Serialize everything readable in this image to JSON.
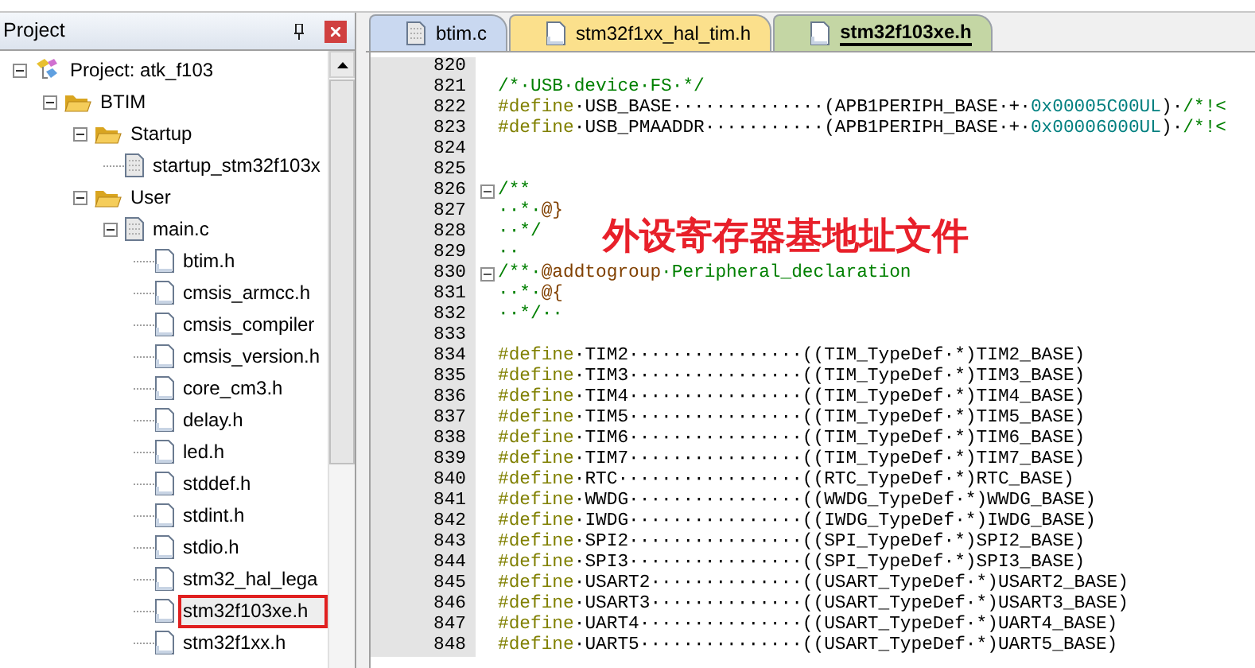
{
  "project_panel": {
    "title": "Project",
    "tree": [
      {
        "label": "Project: atk_f103",
        "kind": "project",
        "expanded": true,
        "selected": false,
        "children": [
          {
            "label": "BTIM",
            "kind": "target",
            "expanded": true,
            "selected": false,
            "children": [
              {
                "label": "Startup",
                "kind": "group",
                "expanded": true,
                "selected": false,
                "children": [
                  {
                    "label": "startup_stm32f103x",
                    "kind": "source",
                    "selected": false
                  }
                ]
              },
              {
                "label": "User",
                "kind": "group",
                "expanded": true,
                "selected": false,
                "children": [
                  {
                    "label": "main.c",
                    "kind": "source",
                    "expanded": true,
                    "selected": false,
                    "children": [
                      {
                        "label": "btim.h",
                        "kind": "header",
                        "selected": false
                      },
                      {
                        "label": "cmsis_armcc.h",
                        "kind": "header",
                        "selected": false
                      },
                      {
                        "label": "cmsis_compiler",
                        "kind": "header",
                        "selected": false
                      },
                      {
                        "label": "cmsis_version.h",
                        "kind": "header",
                        "selected": false
                      },
                      {
                        "label": "core_cm3.h",
                        "kind": "header",
                        "selected": false
                      },
                      {
                        "label": "delay.h",
                        "kind": "header",
                        "selected": false
                      },
                      {
                        "label": "led.h",
                        "kind": "header",
                        "selected": false
                      },
                      {
                        "label": "stddef.h",
                        "kind": "header",
                        "selected": false
                      },
                      {
                        "label": "stdint.h",
                        "kind": "header",
                        "selected": false
                      },
                      {
                        "label": "stdio.h",
                        "kind": "header",
                        "selected": false
                      },
                      {
                        "label": "stm32_hal_lega",
                        "kind": "header",
                        "selected": false
                      },
                      {
                        "label": "stm32f103xe.h",
                        "kind": "header",
                        "selected": true
                      },
                      {
                        "label": "stm32f1xx.h",
                        "kind": "header",
                        "selected": false
                      }
                    ]
                  }
                ]
              }
            ]
          }
        ]
      }
    ]
  },
  "tabs": [
    {
      "label": "btim.c",
      "selected": false,
      "color": "#c9d8f0"
    },
    {
      "label": "stm32f1xx_hal_tim.h",
      "selected": false,
      "color": "#fbe08c"
    },
    {
      "label": "stm32f103xe.h",
      "selected": true,
      "color": "#c4d6a4"
    }
  ],
  "annotation": "外设寄存器基地址文件",
  "code_lines": [
    {
      "number": "820",
      "fold": false
    },
    {
      "number": "821",
      "fold": false,
      "parts": [
        {
          "kind": "comment",
          "text": "/*·USB·device·FS·*/"
        }
      ]
    },
    {
      "number": "822",
      "fold": false,
      "parts": [
        {
          "kind": "keyword",
          "text": "#define"
        },
        {
          "kind": "plain",
          "text": "·USB_BASE··············(APB1PERIPH_BASE·+·"
        },
        {
          "kind": "number",
          "text": "0x00005C00UL"
        },
        {
          "kind": "plain",
          "text": ")·"
        },
        {
          "kind": "comment",
          "text": "/*!<"
        }
      ]
    },
    {
      "number": "823",
      "fold": false,
      "parts": [
        {
          "kind": "keyword",
          "text": "#define"
        },
        {
          "kind": "plain",
          "text": "·USB_PMAADDR···········(APB1PERIPH_BASE·+·"
        },
        {
          "kind": "number",
          "text": "0x00006000UL"
        },
        {
          "kind": "plain",
          "text": ")·"
        },
        {
          "kind": "comment",
          "text": "/*!<"
        }
      ]
    },
    {
      "number": "824",
      "fold": false
    },
    {
      "number": "825",
      "fold": false
    },
    {
      "number": "826",
      "fold": true,
      "parts": [
        {
          "kind": "comment",
          "text": "/**"
        }
      ]
    },
    {
      "number": "827",
      "fold": false,
      "parts": [
        {
          "kind": "comment",
          "text": "··*·"
        },
        {
          "kind": "tag",
          "text": "@}"
        }
      ]
    },
    {
      "number": "828",
      "fold": false,
      "parts": [
        {
          "kind": "comment",
          "text": "··*/"
        }
      ]
    },
    {
      "number": "829",
      "fold": false,
      "parts": [
        {
          "kind": "comment",
          "text": "··"
        }
      ]
    },
    {
      "number": "830",
      "fold": true,
      "parts": [
        {
          "kind": "comment",
          "text": "/**·"
        },
        {
          "kind": "tag",
          "text": "@addtogroup"
        },
        {
          "kind": "comment",
          "text": "·Peripheral_declaration"
        }
      ]
    },
    {
      "number": "831",
      "fold": false,
      "parts": [
        {
          "kind": "comment",
          "text": "··*·"
        },
        {
          "kind": "tag",
          "text": "@{"
        }
      ]
    },
    {
      "number": "832",
      "fold": false,
      "parts": [
        {
          "kind": "comment",
          "text": "··*/··"
        }
      ]
    },
    {
      "number": "833",
      "fold": false
    },
    {
      "number": "834",
      "fold": false,
      "parts": [
        {
          "kind": "keyword",
          "text": "#define"
        },
        {
          "kind": "plain",
          "text": "·TIM2················((TIM_TypeDef·*)TIM2_BASE)"
        }
      ]
    },
    {
      "number": "835",
      "fold": false,
      "parts": [
        {
          "kind": "keyword",
          "text": "#define"
        },
        {
          "kind": "plain",
          "text": "·TIM3················((TIM_TypeDef·*)TIM3_BASE)"
        }
      ]
    },
    {
      "number": "836",
      "fold": false,
      "parts": [
        {
          "kind": "keyword",
          "text": "#define"
        },
        {
          "kind": "plain",
          "text": "·TIM4················((TIM_TypeDef·*)TIM4_BASE)"
        }
      ]
    },
    {
      "number": "837",
      "fold": false,
      "parts": [
        {
          "kind": "keyword",
          "text": "#define"
        },
        {
          "kind": "plain",
          "text": "·TIM5················((TIM_TypeDef·*)TIM5_BASE)"
        }
      ]
    },
    {
      "number": "838",
      "fold": false,
      "parts": [
        {
          "kind": "keyword",
          "text": "#define"
        },
        {
          "kind": "plain",
          "text": "·TIM6················((TIM_TypeDef·*)TIM6_BASE)"
        }
      ]
    },
    {
      "number": "839",
      "fold": false,
      "parts": [
        {
          "kind": "keyword",
          "text": "#define"
        },
        {
          "kind": "plain",
          "text": "·TIM7················((TIM_TypeDef·*)TIM7_BASE)"
        }
      ]
    },
    {
      "number": "840",
      "fold": false,
      "parts": [
        {
          "kind": "keyword",
          "text": "#define"
        },
        {
          "kind": "plain",
          "text": "·RTC·················((RTC_TypeDef·*)RTC_BASE)"
        }
      ]
    },
    {
      "number": "841",
      "fold": false,
      "parts": [
        {
          "kind": "keyword",
          "text": "#define"
        },
        {
          "kind": "plain",
          "text": "·WWDG················((WWDG_TypeDef·*)WWDG_BASE)"
        }
      ]
    },
    {
      "number": "842",
      "fold": false,
      "parts": [
        {
          "kind": "keyword",
          "text": "#define"
        },
        {
          "kind": "plain",
          "text": "·IWDG················((IWDG_TypeDef·*)IWDG_BASE)"
        }
      ]
    },
    {
      "number": "843",
      "fold": false,
      "parts": [
        {
          "kind": "keyword",
          "text": "#define"
        },
        {
          "kind": "plain",
          "text": "·SPI2················((SPI_TypeDef·*)SPI2_BASE)"
        }
      ]
    },
    {
      "number": "844",
      "fold": false,
      "parts": [
        {
          "kind": "keyword",
          "text": "#define"
        },
        {
          "kind": "plain",
          "text": "·SPI3················((SPI_TypeDef·*)SPI3_BASE)"
        }
      ]
    },
    {
      "number": "845",
      "fold": false,
      "parts": [
        {
          "kind": "keyword",
          "text": "#define"
        },
        {
          "kind": "plain",
          "text": "·USART2··············((USART_TypeDef·*)USART2_BASE)"
        }
      ]
    },
    {
      "number": "846",
      "fold": false,
      "parts": [
        {
          "kind": "keyword",
          "text": "#define"
        },
        {
          "kind": "plain",
          "text": "·USART3··············((USART_TypeDef·*)USART3_BASE)"
        }
      ]
    },
    {
      "number": "847",
      "fold": false,
      "parts": [
        {
          "kind": "keyword",
          "text": "#define"
        },
        {
          "kind": "plain",
          "text": "·UART4···············((USART_TypeDef·*)UART4_BASE)"
        }
      ]
    },
    {
      "number": "848",
      "fold": false,
      "parts": [
        {
          "kind": "keyword",
          "text": "#define"
        },
        {
          "kind": "plain",
          "text": "·UART5···············((USART_TypeDef·*)UART5_BASE)"
        }
      ]
    }
  ]
}
